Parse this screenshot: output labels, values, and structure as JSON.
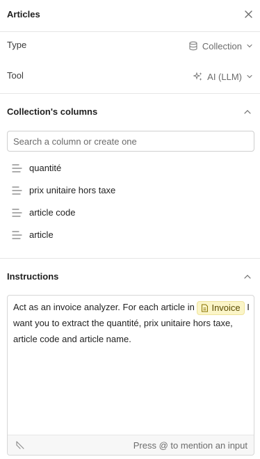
{
  "header": {
    "title": "Articles"
  },
  "type_row": {
    "label": "Type",
    "value": "Collection"
  },
  "tool_row": {
    "label": "Tool",
    "value": "AI (LLM)"
  },
  "columns_section": {
    "title": "Collection's columns",
    "search_placeholder": "Search a column or create one",
    "columns": [
      {
        "label": "quantité"
      },
      {
        "label": "prix unitaire hors taxe"
      },
      {
        "label": "article code"
      },
      {
        "label": "article"
      }
    ]
  },
  "instructions_section": {
    "title": "Instructions",
    "text_before_chip": "Act as an invoice analyzer. For each article in ",
    "chip_label": "Invoice",
    "text_after_chip": " I want you to extract the quantité, prix unitaire hors taxe, article code and article name.",
    "footer_hint": "Press @ to mention an input"
  },
  "colors": {
    "chip_bg": "#fbf5c8",
    "border": "#e6e6e6",
    "muted_text": "#6b6b6b"
  }
}
